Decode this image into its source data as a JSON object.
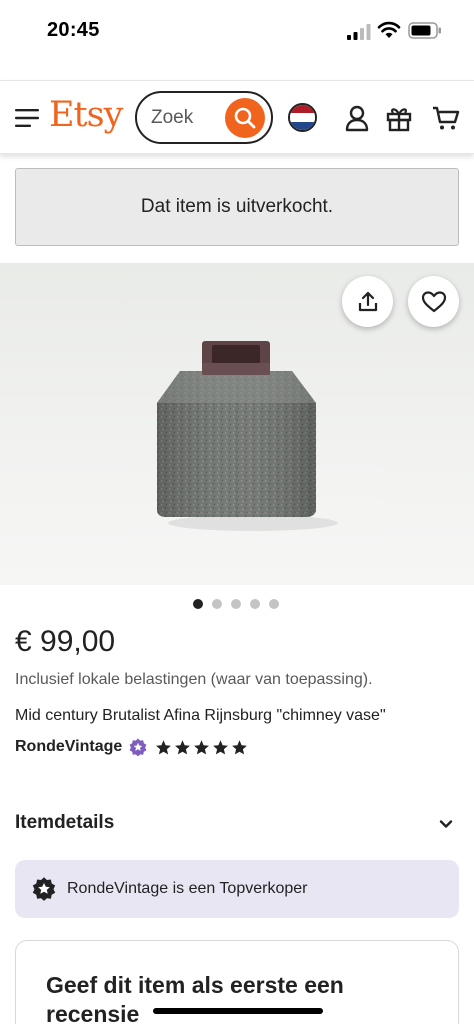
{
  "status_bar": {
    "time": "20:45"
  },
  "header": {
    "logo": "Etsy",
    "search": {
      "placeholder": "Zoek"
    },
    "icons": [
      "menu-icon",
      "search-icon",
      "netherlands-flag-icon",
      "account-icon",
      "gift-icon",
      "cart-icon"
    ]
  },
  "banner": {
    "sold_out": "Dat item is uitverkocht."
  },
  "gallery": {
    "image_count": 5,
    "active_index": 0
  },
  "listing": {
    "price": "€ 99,00",
    "tax_note": "Inclusief lokale belastingen (waar van toepassing).",
    "title": "Mid century Brutalist Afina Rijnsburg \"chimney vase\"",
    "shop_name": "RondeVintage",
    "rating": 5
  },
  "sections": {
    "item_details": "Itemdetails",
    "top_seller": "RondeVintage is een Topverkoper",
    "review_prompt": "Geef dit item als eerste een recensie"
  },
  "colors": {
    "brand": "#F1641E",
    "star_seller": "#7F5DBE",
    "top_seller_bg": "#E9E6F3"
  }
}
